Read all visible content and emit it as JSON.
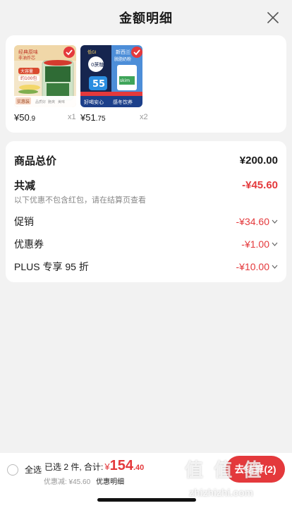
{
  "header": {
    "title": "金额明细",
    "close_icon": "close-icon"
  },
  "products": [
    {
      "image_texts": [
        "经典原味",
        "非油炸芯",
        "大容量",
        "约100包",
        "实惠装",
        "品质好",
        "脆爽",
        "美味"
      ],
      "price_prefix": "¥",
      "price_int": "50",
      "price_dec": ".9",
      "qty": "x1"
    },
    {
      "image_texts": [
        "低GI",
        "0蔗糖",
        "新西兰",
        "脱脂奶粉",
        "55",
        "好喝安心",
        "感冬饮养",
        "skim"
      ],
      "price_prefix": "¥",
      "price_int": "51",
      "price_dec": ".75",
      "qty": "x2"
    }
  ],
  "summary": {
    "total_label": "商品总价",
    "total_value": "¥200.00",
    "reduce_label": "共减",
    "reduce_value": "-¥45.60",
    "note": "以下优惠不包含红包，请在结算页查看",
    "items": [
      {
        "label": "促销",
        "value": "-¥34.60"
      },
      {
        "label": "优惠券",
        "value": "-¥1.00"
      },
      {
        "label": "PLUS 专享 95 折",
        "value": "-¥10.00"
      }
    ]
  },
  "bottom": {
    "select_all": "全选",
    "selected_text": "已选 2 件, 合计:",
    "total_symbol": "¥",
    "total_int": "154",
    "total_dec": ".40",
    "discount_text": "优惠减: ¥45.60",
    "detail_link": "优惠明细",
    "checkout_label": "去结算(2)"
  },
  "watermark": {
    "text": "值 值 值",
    "url": "zhizhizhi.com"
  },
  "colors": {
    "accent": "#e4393c",
    "background": "#f2f2f2",
    "card": "#ffffff"
  }
}
